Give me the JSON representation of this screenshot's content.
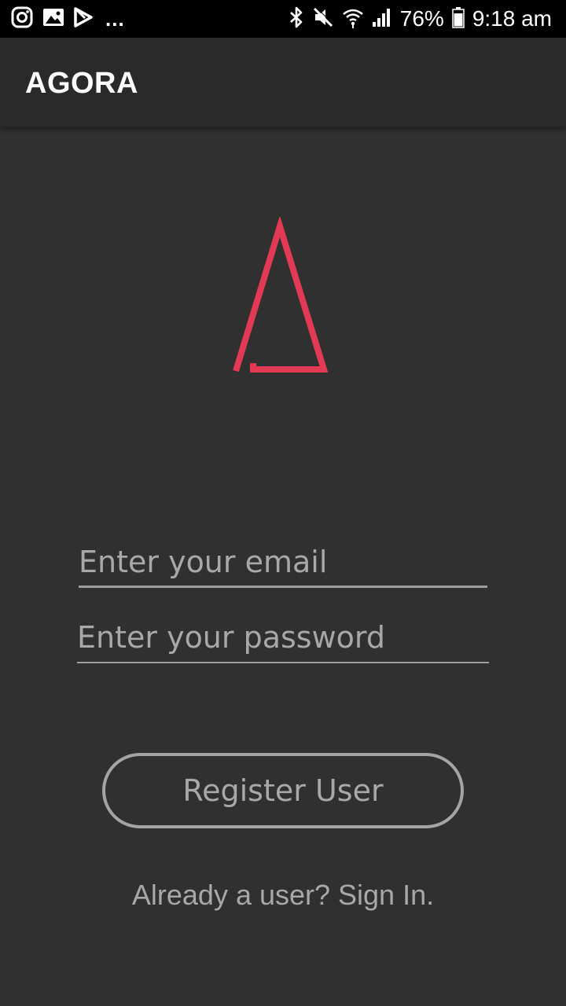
{
  "status_bar": {
    "left_icons": [
      "instagram-icon",
      "gallery-icon",
      "play-store-icon"
    ],
    "overflow": "...",
    "right_icons": [
      "bluetooth-icon",
      "mute-icon",
      "wifi-icon",
      "signal-icon"
    ],
    "battery": "76%",
    "time": "9:18 am"
  },
  "app_bar": {
    "title": "AGORA"
  },
  "logo": {
    "icon": "agora-logo-icon",
    "color": "#e23a55"
  },
  "form": {
    "email_placeholder": "Enter your email",
    "password_placeholder": "Enter your password"
  },
  "actions": {
    "register_label": "Register User",
    "signin_label": "Already a user? Sign In."
  },
  "colors": {
    "background": "#303030",
    "app_bar": "#2a2a2a",
    "accent": "#e23a55",
    "muted_text": "#a8a8a8"
  }
}
